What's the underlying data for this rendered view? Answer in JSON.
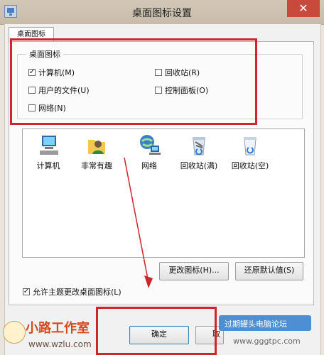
{
  "window": {
    "title": "桌面图标设置",
    "close_glyph": "✕"
  },
  "tab": {
    "label": "桌面图标"
  },
  "group": {
    "legend": "桌面图标",
    "checkboxes": [
      {
        "label": "计算机(M)",
        "checked": true
      },
      {
        "label": "回收站(R)",
        "checked": false
      },
      {
        "label": "用户的文件(U)",
        "checked": false
      },
      {
        "label": "控制面板(O)",
        "checked": false
      },
      {
        "label": "网络(N)",
        "checked": false
      }
    ]
  },
  "icons": [
    {
      "label": "计算机",
      "icon": "computer-icon"
    },
    {
      "label": "非常有趣",
      "icon": "user-folder-icon"
    },
    {
      "label": "网络",
      "icon": "network-icon"
    },
    {
      "label": "回收站(满)",
      "icon": "recycle-bin-full-icon"
    },
    {
      "label": "回收站(空)",
      "icon": "recycle-bin-empty-icon"
    }
  ],
  "buttons": {
    "change_icon": "更改图标(H)...",
    "restore_default": "还原默认值(S)",
    "ok": "确定",
    "cancel_partial": "取"
  },
  "allow_themes": {
    "label": "允许主题更改桌面图标(L)",
    "checked": true
  },
  "watermarks": {
    "left_brand": "小路工作室",
    "left_url": "www.wzlu.com",
    "right_brand": "过期罐头电脑论坛",
    "right_url": "www.gggtpc.com"
  },
  "colors": {
    "accent_red": "#d0242d"
  }
}
